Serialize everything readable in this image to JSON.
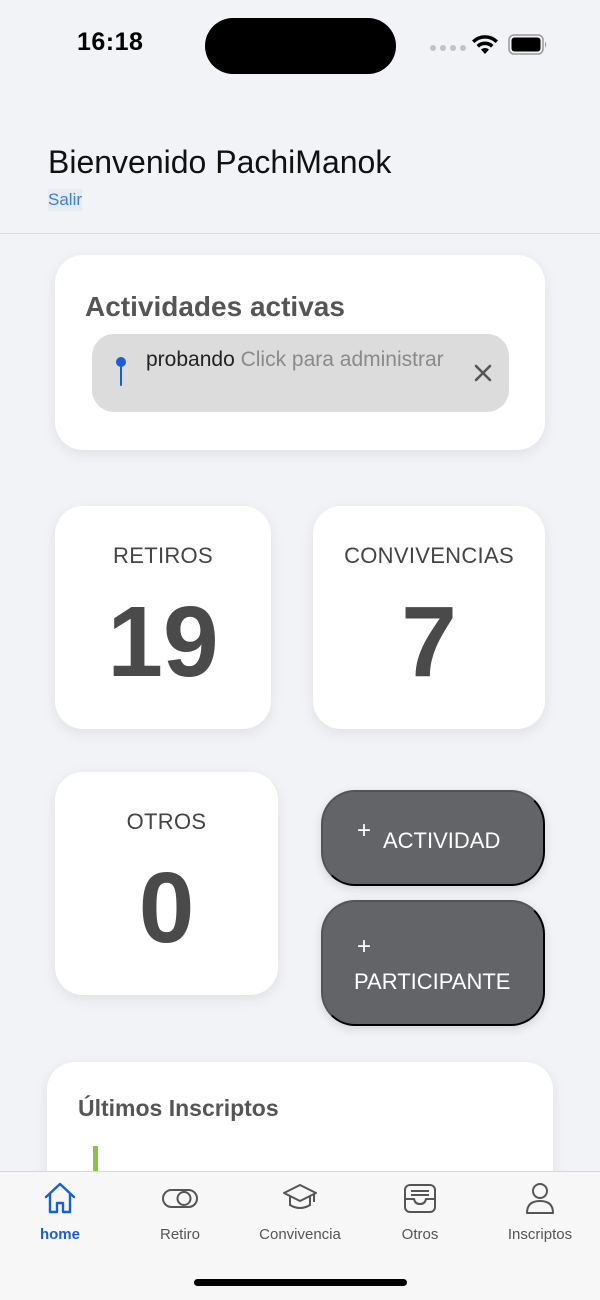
{
  "status_bar": {
    "time": "16:18"
  },
  "header": {
    "welcome": "Bienvenido PachiManok",
    "logout_label": "Salir"
  },
  "active_activities": {
    "title": "Actividades activas",
    "items": [
      {
        "name": "probando",
        "hint": "Click para administrar"
      }
    ]
  },
  "stats": {
    "retiros": {
      "label": "RETIROS",
      "value": "19"
    },
    "convivencias": {
      "label": "CONVIVENCIAS",
      "value": "7"
    },
    "otros": {
      "label": "OTROS",
      "value": "0"
    }
  },
  "actions": {
    "add_activity": {
      "plus": "+",
      "label": "ACTIVIDAD"
    },
    "add_participant": {
      "plus": "+",
      "label": "PARTICIPANTE"
    }
  },
  "latest": {
    "title": "Últimos Inscriptos"
  },
  "tabbar": {
    "items": [
      {
        "label": "home",
        "icon": "home-icon",
        "active": true
      },
      {
        "label": "Retiro",
        "icon": "toggle-icon",
        "active": false
      },
      {
        "label": "Convivencia",
        "icon": "graduation-cap-icon",
        "active": false
      },
      {
        "label": "Otros",
        "icon": "tray-icon",
        "active": false
      },
      {
        "label": "Inscriptos",
        "icon": "person-icon",
        "active": false
      }
    ]
  },
  "colors": {
    "accent": "#1a5fd1",
    "button": "#636467",
    "link": "#3e7fc7",
    "latest_marker": "#8bc34a"
  }
}
